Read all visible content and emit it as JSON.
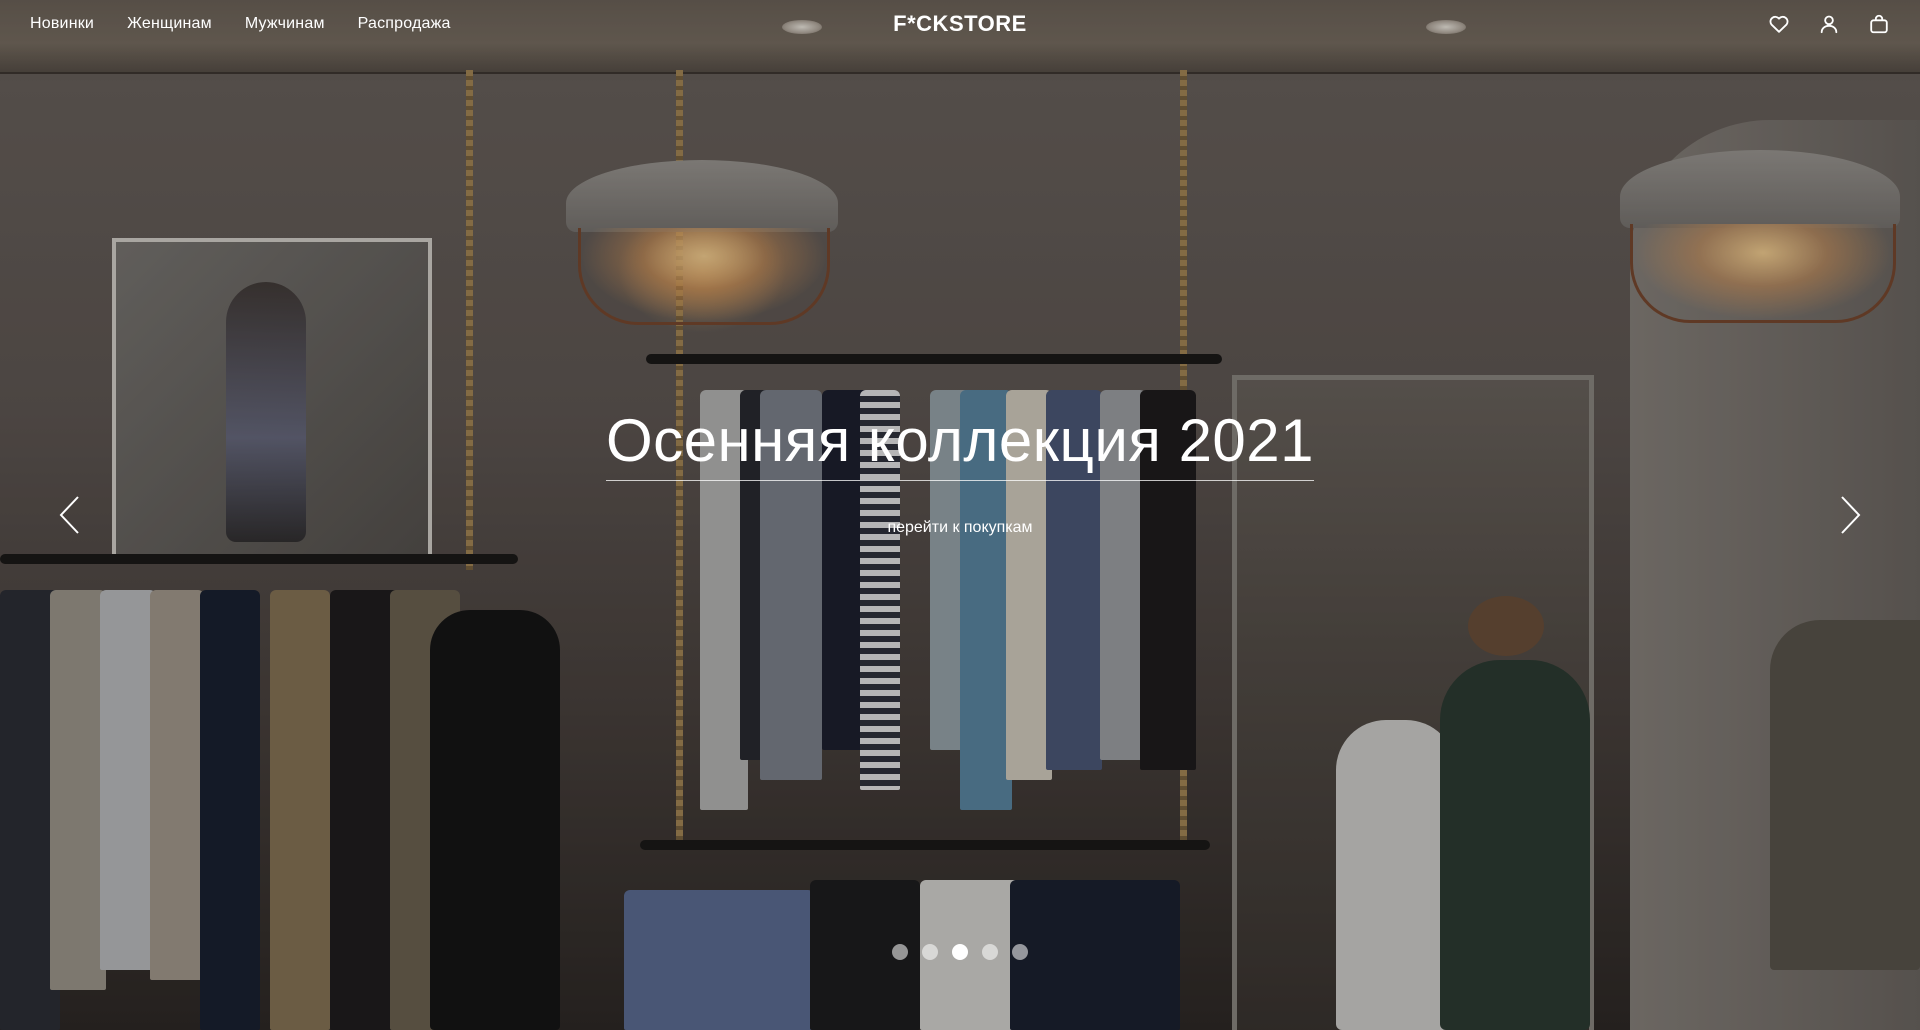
{
  "brand": {
    "logo_text": "F*CKSTORE"
  },
  "nav": {
    "items": [
      {
        "label": "Новинки"
      },
      {
        "label": "Женщинам"
      },
      {
        "label": "Мужчинам"
      },
      {
        "label": "Распродажа"
      }
    ]
  },
  "header_icons": [
    "heart-icon",
    "user-icon",
    "shopping-bag-icon"
  ],
  "hero": {
    "title": "Осенняя коллекция 2021",
    "cta_label": "перейти к покупкам"
  },
  "slider": {
    "slide_count": 5,
    "active_index": 2,
    "prev_icon": "chevron-left-icon",
    "next_icon": "chevron-right-icon"
  },
  "colors": {
    "text": "#ffffff",
    "dot_inactive": "rgba(255,255,255,0.55)",
    "dot_active": "#ffffff"
  }
}
